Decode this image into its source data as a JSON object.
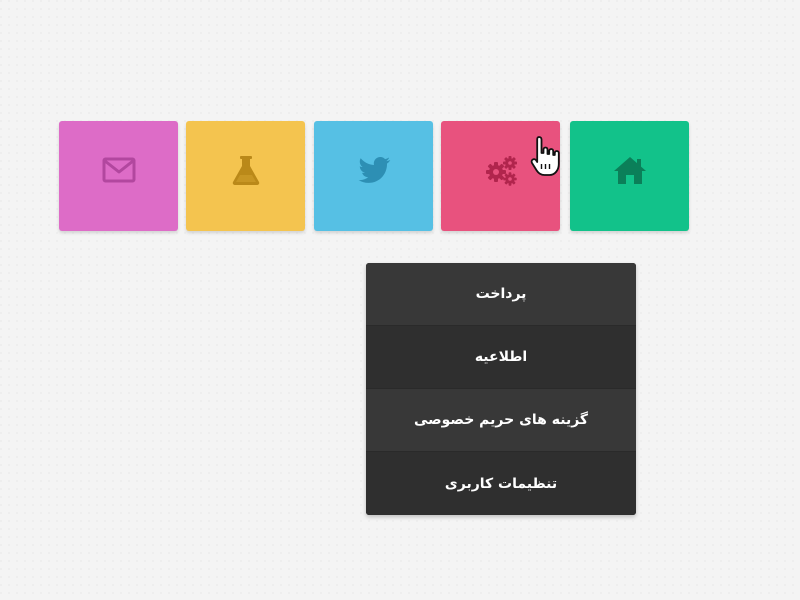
{
  "tiles": [
    {
      "name": "mail",
      "icon": "mail-icon",
      "color": "#dd6cc7",
      "icon_color": "#b2479f"
    },
    {
      "name": "lab",
      "icon": "flask-icon",
      "color": "#f4c44f",
      "icon_color": "#ba8919"
    },
    {
      "name": "twitter",
      "icon": "twitter-icon",
      "color": "#56c0e4",
      "icon_color": "#2d8fb4"
    },
    {
      "name": "settings",
      "icon": "gears-icon",
      "color": "#e8527e",
      "icon_color": "#b1254d"
    },
    {
      "name": "home",
      "icon": "home-icon",
      "color": "#12c28a",
      "icon_color": "#0b7f59"
    }
  ],
  "dropdown": {
    "items": [
      {
        "label": "پرداخت"
      },
      {
        "label": "اطلاعیه"
      },
      {
        "label": "گزینه های حریم خصوصی"
      },
      {
        "label": "تنظیمات کاربری"
      }
    ]
  },
  "cursor": {
    "icon": "hand-cursor-icon"
  }
}
